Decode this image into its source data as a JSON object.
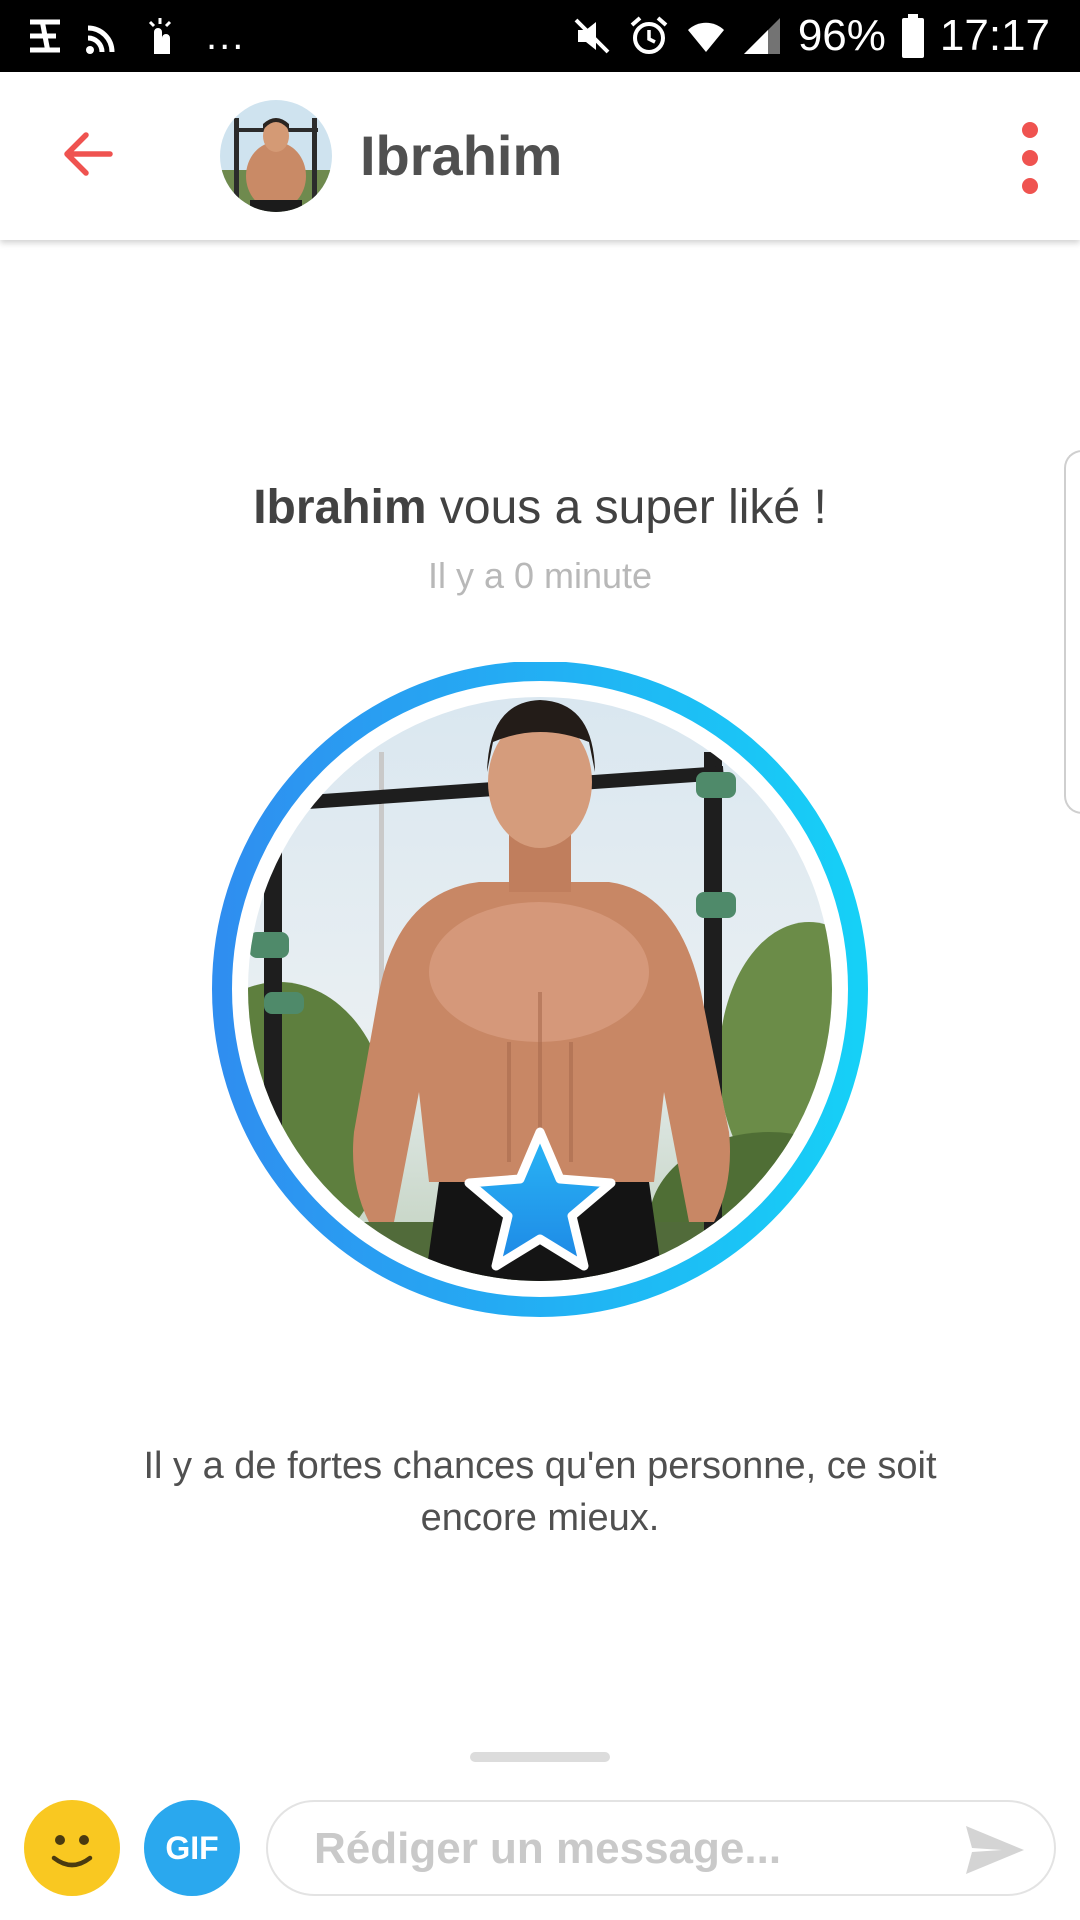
{
  "status_bar": {
    "battery": "96%",
    "time": "17:17",
    "overflow": "..."
  },
  "header": {
    "name": "Ibrahim"
  },
  "super_like": {
    "name": "Ibrahim",
    "message": " vous a super liké !",
    "time": "Il y a 0 minute"
  },
  "tagline": "Il y a de fortes chances qu'en personne, ce soit encore mieux.",
  "composer": {
    "gif_label": "GIF",
    "placeholder": "Rédiger un message..."
  },
  "colors": {
    "accent": "#ef5350",
    "superlike_blue": "#1e9ff2",
    "emoji_yellow": "#f9c821"
  }
}
